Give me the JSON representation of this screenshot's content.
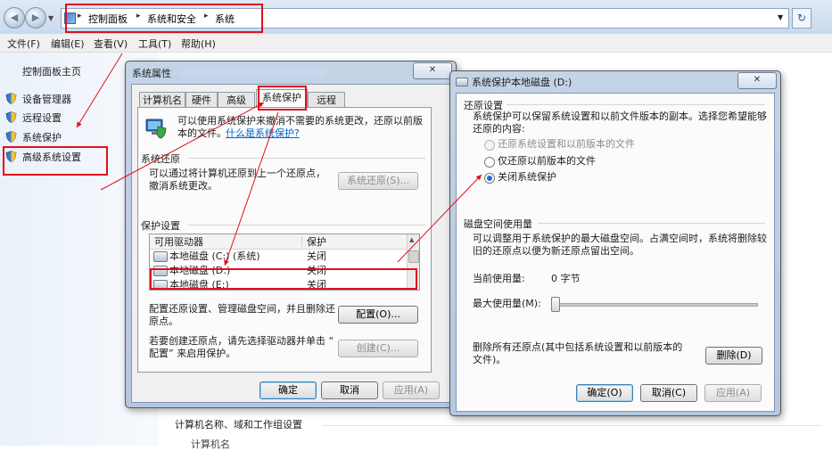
{
  "explorer": {
    "breadcrumb": [
      "控制面板",
      "系统和安全",
      "系统"
    ],
    "menu": [
      "文件(F)",
      "编辑(E)",
      "查看(V)",
      "工具(T)",
      "帮助(H)"
    ],
    "left_home": "控制面板主页",
    "left_links": [
      "设备管理器",
      "远程设置",
      "系统保护",
      "高级系统设置"
    ],
    "main_section": "计算机名称、域和工作组设置",
    "main_partial_row": "计算机名"
  },
  "props_dialog": {
    "title": "系统属性",
    "tabs": [
      "计算机名",
      "硬件",
      "高级",
      "系统保护",
      "远程"
    ],
    "active_tab": "系统保护",
    "intro_line1": "可以使用系统保护来撤消不需要的系统更改，还原以前版",
    "intro_line2": "本的文件。",
    "intro_link": "什么是系统保护?",
    "restore_group": "系统还原",
    "restore_text_line1": "可以通过将计算机还原到上一个还原点，",
    "restore_text_line2": "撤消系统更改。",
    "restore_button": "系统还原(S)...",
    "protection_group": "保护设置",
    "col_drive": "可用驱动器",
    "col_protect": "保护",
    "drives": [
      {
        "name": "本地磁盘 (C:) (系统)",
        "status": "关闭"
      },
      {
        "name": "本地磁盘 (D:)",
        "status": "关闭"
      },
      {
        "name": "本地磁盘 (E:)",
        "status": "关闭"
      }
    ],
    "config_text_line1": "配置还原设置、管理磁盘空间，并且删除还",
    "config_text_line2": "原点。",
    "config_button": "配置(O)...",
    "create_text_line1": "若要创建还原点，请先选择驱动器并单击 “",
    "create_text_line2": "配置” 来启用保护。",
    "create_button": "创建(C)...",
    "ok": "确定",
    "cancel": "取消",
    "apply": "应用(A)"
  },
  "protect_dialog": {
    "title": "系统保护本地磁盘 (D:)",
    "restore_group": "还原设置",
    "desc_line1": "系统保护可以保留系统设置和以前文件版本的副本。选择您希望能够",
    "desc_line2": "还原的内容:",
    "options": [
      "还原系统设置和以前版本的文件",
      "仅还原以前版本的文件",
      "关闭系统保护"
    ],
    "selected_option": "关闭系统保护",
    "disk_group": "磁盘空间使用量",
    "disk_desc_line1": "可以调整用于系统保护的最大磁盘空间。占满空间时，系统将删除较",
    "disk_desc_line2": "旧的还原点以便为新还原点留出空间。",
    "current_usage_label": "当前使用量:",
    "current_usage_value": "0 字节",
    "max_usage_label": "最大使用量(M):",
    "max_usage_fraction": 0,
    "delete_text_line1": "删除所有还原点(其中包括系统设置和以前版本的",
    "delete_text_line2": "文件)。",
    "delete_button": "删除(D)",
    "ok": "确定(O)",
    "cancel": "取消(C)",
    "apply": "应用(A)"
  },
  "colors": {
    "annotation_red": "#e0101e",
    "link_blue": "#0066cc"
  }
}
